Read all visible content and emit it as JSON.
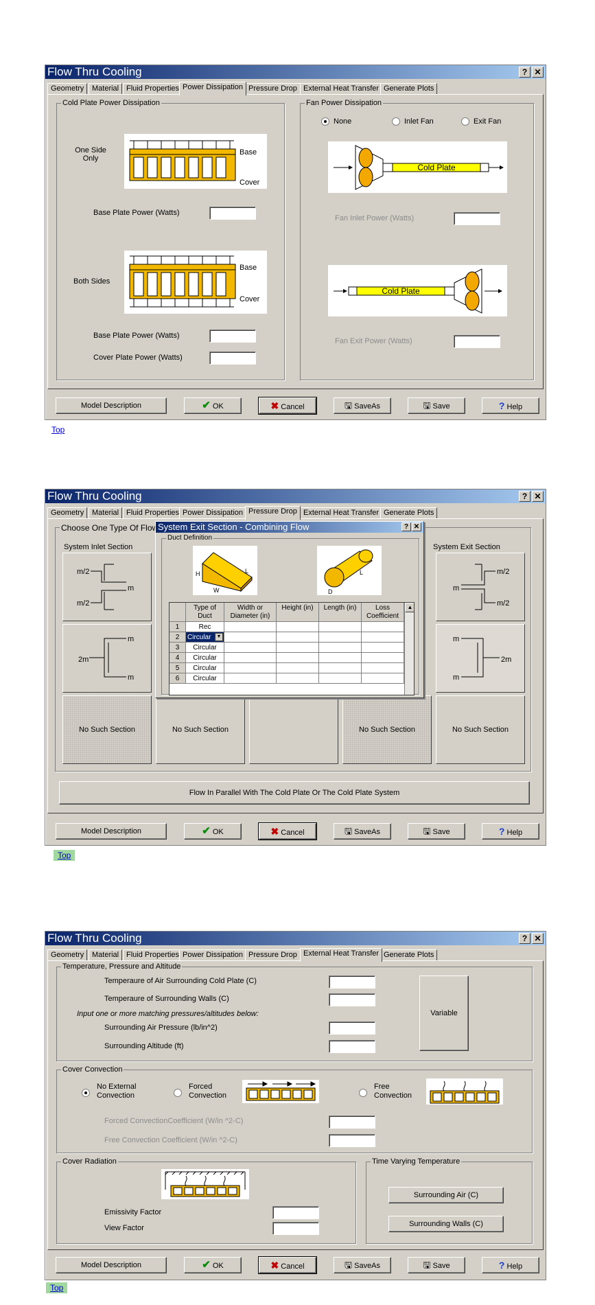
{
  "app": {
    "title": "Flow Thru Cooling"
  },
  "titlebar_buttons": {
    "help": "?",
    "close": "✕"
  },
  "tabs": [
    "Geometry",
    "Material",
    "Fluid Properties",
    "Power Dissipation",
    "Pressure Drop",
    "External Heat Transfer",
    "Generate Plots"
  ],
  "footer": {
    "model_description": "Model Description",
    "ok": "OK",
    "cancel": "Cancel",
    "saveas": "SaveAs",
    "save": "Save",
    "help": "Help"
  },
  "top_link": "Top",
  "power": {
    "cold_group": "Cold Plate Power Dissipation",
    "fan_group": "Fan Power Dissipation",
    "one_side": "One Side Only",
    "both_sides": "Both Sides",
    "base": "Base",
    "cover": "Cover",
    "base_power_1": "Base Plate Power (Watts)",
    "base_power_2": "Base Plate Power (Watts)",
    "cover_power": "Cover Plate Power (Watts)",
    "fan_none": "None",
    "fan_inlet": "Inlet Fan",
    "fan_exit": "Exit Fan",
    "cold_plate": "Cold Plate",
    "fan_inlet_power": "Fan Inlet  Power (Watts)",
    "fan_exit_power": "Fan Exit  Power (Watts)",
    "selected_fan": "None"
  },
  "pressure": {
    "choose": "Choose One Type Of Flow C",
    "inlet_section": "System Inlet Section",
    "exit_section": "System Exit Section",
    "m_half_a": "m/2",
    "m_half_b": "m/2",
    "m": "m",
    "two_m": "2m",
    "no_such_section": "No Such Section",
    "flow_parallel": "Flow In Parallel With The Cold Plate Or The Cold Plate System",
    "popup": {
      "title": "System Exit Section  - Combining Flow",
      "group": "Duct Definition",
      "rect_labels": {
        "h": "H",
        "w": "W",
        "l": "L"
      },
      "circ_labels": {
        "d": "D",
        "l": "L"
      },
      "headers": [
        "Type of Duct",
        "Width or Diameter  (in)",
        "Height (in)",
        "Length (in)",
        "Loss Coefficient"
      ],
      "rows": [
        {
          "n": "1",
          "type": "Rec"
        },
        {
          "n": "2",
          "type": "Circular"
        },
        {
          "n": "3",
          "type": "Circular"
        },
        {
          "n": "4",
          "type": "Circular"
        },
        {
          "n": "5",
          "type": "Circular"
        },
        {
          "n": "6",
          "type": "Circular"
        }
      ]
    }
  },
  "external": {
    "tpa_group": "Temperature, Pressure and Altitude",
    "temp_air": "Temperaure of Air Surrounding Cold Plate (C)",
    "temp_walls": "Temperaure of Surrounding Walls (C)",
    "input_note": "Input one or more matching pressures/altitudes below:",
    "air_pressure": "Surrounding Air Pressure (lb/in^2)",
    "altitude": "Surrounding Altitude (ft)",
    "variable": "Variable",
    "cover_conv_group": "Cover Convection",
    "no_external": "No External Convection",
    "forced": "Forced Convection",
    "free": "Free Convection",
    "forced_coef": "Forced ConvectionCoefficient (W/in ^2-C)",
    "free_coef": "Free Convection Coefficient (W/in ^2-C)",
    "cover_rad_group": "Cover Radiation",
    "emissivity": "Emissivity Factor",
    "view_factor": "View Factor",
    "time_group": "Time Varying Temperature",
    "surr_air": "Surrounding Air (C)",
    "surr_walls": "Surrounding Walls (C)",
    "selected_convection": "No External Convection"
  },
  "colors": {
    "dialog": "#d4d0c8",
    "title_start": "#0a246a",
    "title_end": "#a6caf0",
    "plate": "#f2b800",
    "fan": "#f2a800",
    "cold_plate": "#ffff00",
    "link": "#0000cc",
    "top_highlight": "#a0d8a0"
  }
}
